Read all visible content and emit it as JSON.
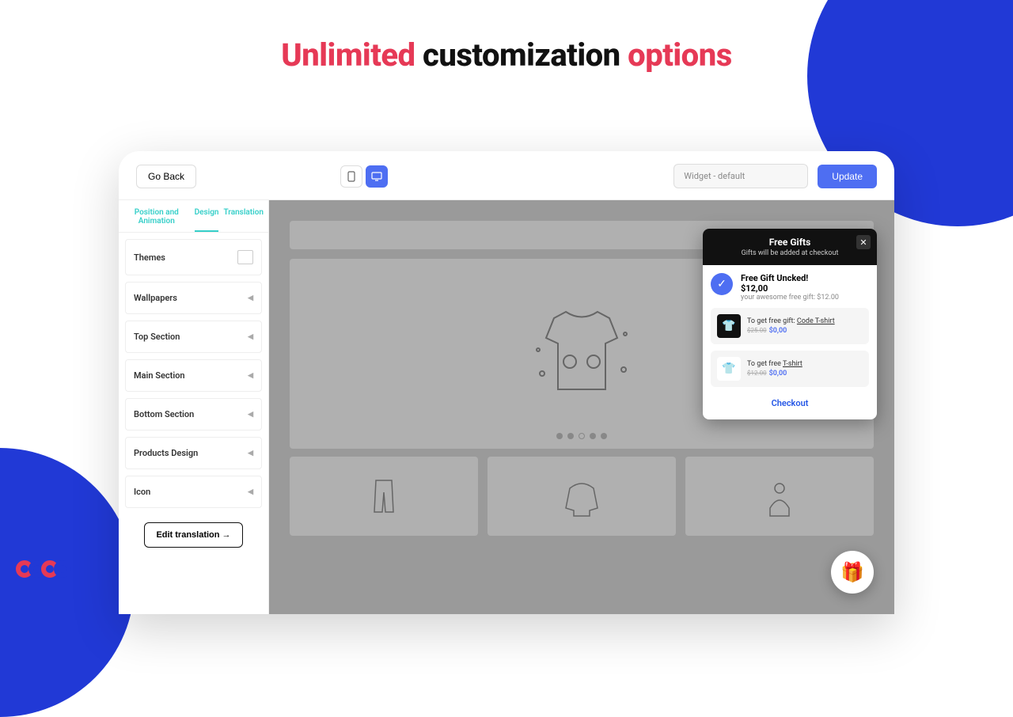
{
  "headline": {
    "w1": "Unlimited",
    "w2": "customization",
    "w3": "options"
  },
  "toolbar": {
    "goBack": "Go Back",
    "widgetSelect": "Widget - default",
    "update": "Update"
  },
  "tabs": {
    "t1": "Position and Animation",
    "t2": "Design",
    "t3": "Translation"
  },
  "panels": {
    "themes": "Themes",
    "wallpapers": "Wallpapers",
    "topSection": "Top Section",
    "mainSection": "Main Section",
    "bottomSection": "Bottom Section",
    "productsDesign": "Products Design",
    "icon": "Icon"
  },
  "editTranslation": "Edit translation →",
  "widget": {
    "title": "Free Gifts",
    "subtitle": "Gifts will be added at checkout",
    "unlock": {
      "title": "Free Gift Uncked!",
      "price": "$12,00",
      "sub": "your awesome free gift: $12.00"
    },
    "gift1": {
      "prefix": "To get free gift: ",
      "name": "Code T-shirt",
      "old": "$25.00",
      "new": "$0,00"
    },
    "gift2": {
      "prefix": "To get free ",
      "name": "T-shirt",
      "old": "$12.00",
      "new": "$0,00"
    },
    "checkout": "Checkout"
  }
}
